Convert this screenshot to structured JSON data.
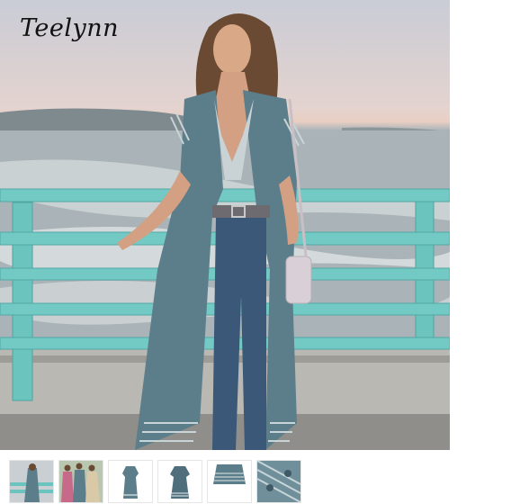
{
  "brand": {
    "logo_text": "Teelynn"
  },
  "hero": {
    "description_icon": "model-photo"
  },
  "thumbnails": [
    {
      "icon": "thumb-pier-photo"
    },
    {
      "icon": "thumb-group-photo"
    },
    {
      "icon": "thumb-dress-front"
    },
    {
      "icon": "thumb-dress-back"
    },
    {
      "icon": "thumb-hem-detail"
    },
    {
      "icon": "thumb-fabric-detail"
    }
  ],
  "colors": {
    "railing": "#6cc4bf",
    "dress": "#5c7d8a",
    "sky": "#e6d2cc"
  }
}
